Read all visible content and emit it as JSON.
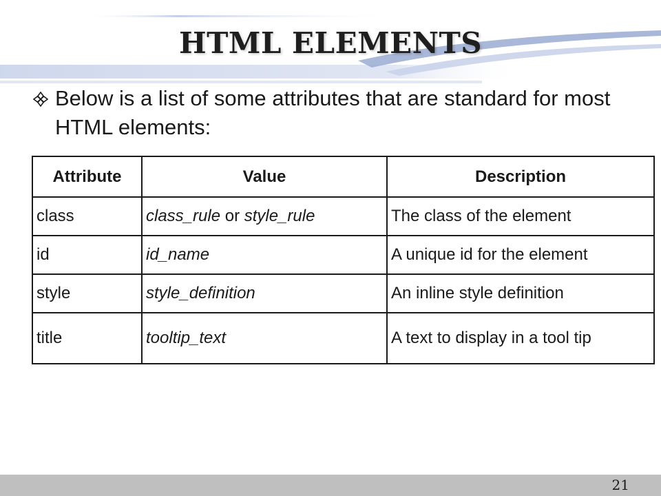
{
  "slide": {
    "title": "HTML ELEMENTS",
    "bullet_text": "Below is a list of some attributes that are standard for most HTML elements:",
    "page_number": "21",
    "colors": {
      "footer": "#bfbfbf",
      "banner": "#c9d3ea",
      "banner_accent": "#9aabd2"
    }
  },
  "table": {
    "headers": {
      "attribute": "Attribute",
      "value": "Value",
      "description": "Description"
    },
    "rows": [
      {
        "attribute": "class",
        "value_a": "class_rule",
        "connector": " or ",
        "value_b": "style_rule",
        "description": "The class of the element"
      },
      {
        "attribute": "id",
        "value_a": "id_name",
        "description": "A unique id for the element"
      },
      {
        "attribute": "style",
        "value_a": "style_definition",
        "description": "An inline style definition"
      },
      {
        "attribute": "title",
        "value_a": "tooltip_text",
        "description": "A text to display in a tool tip"
      }
    ]
  }
}
